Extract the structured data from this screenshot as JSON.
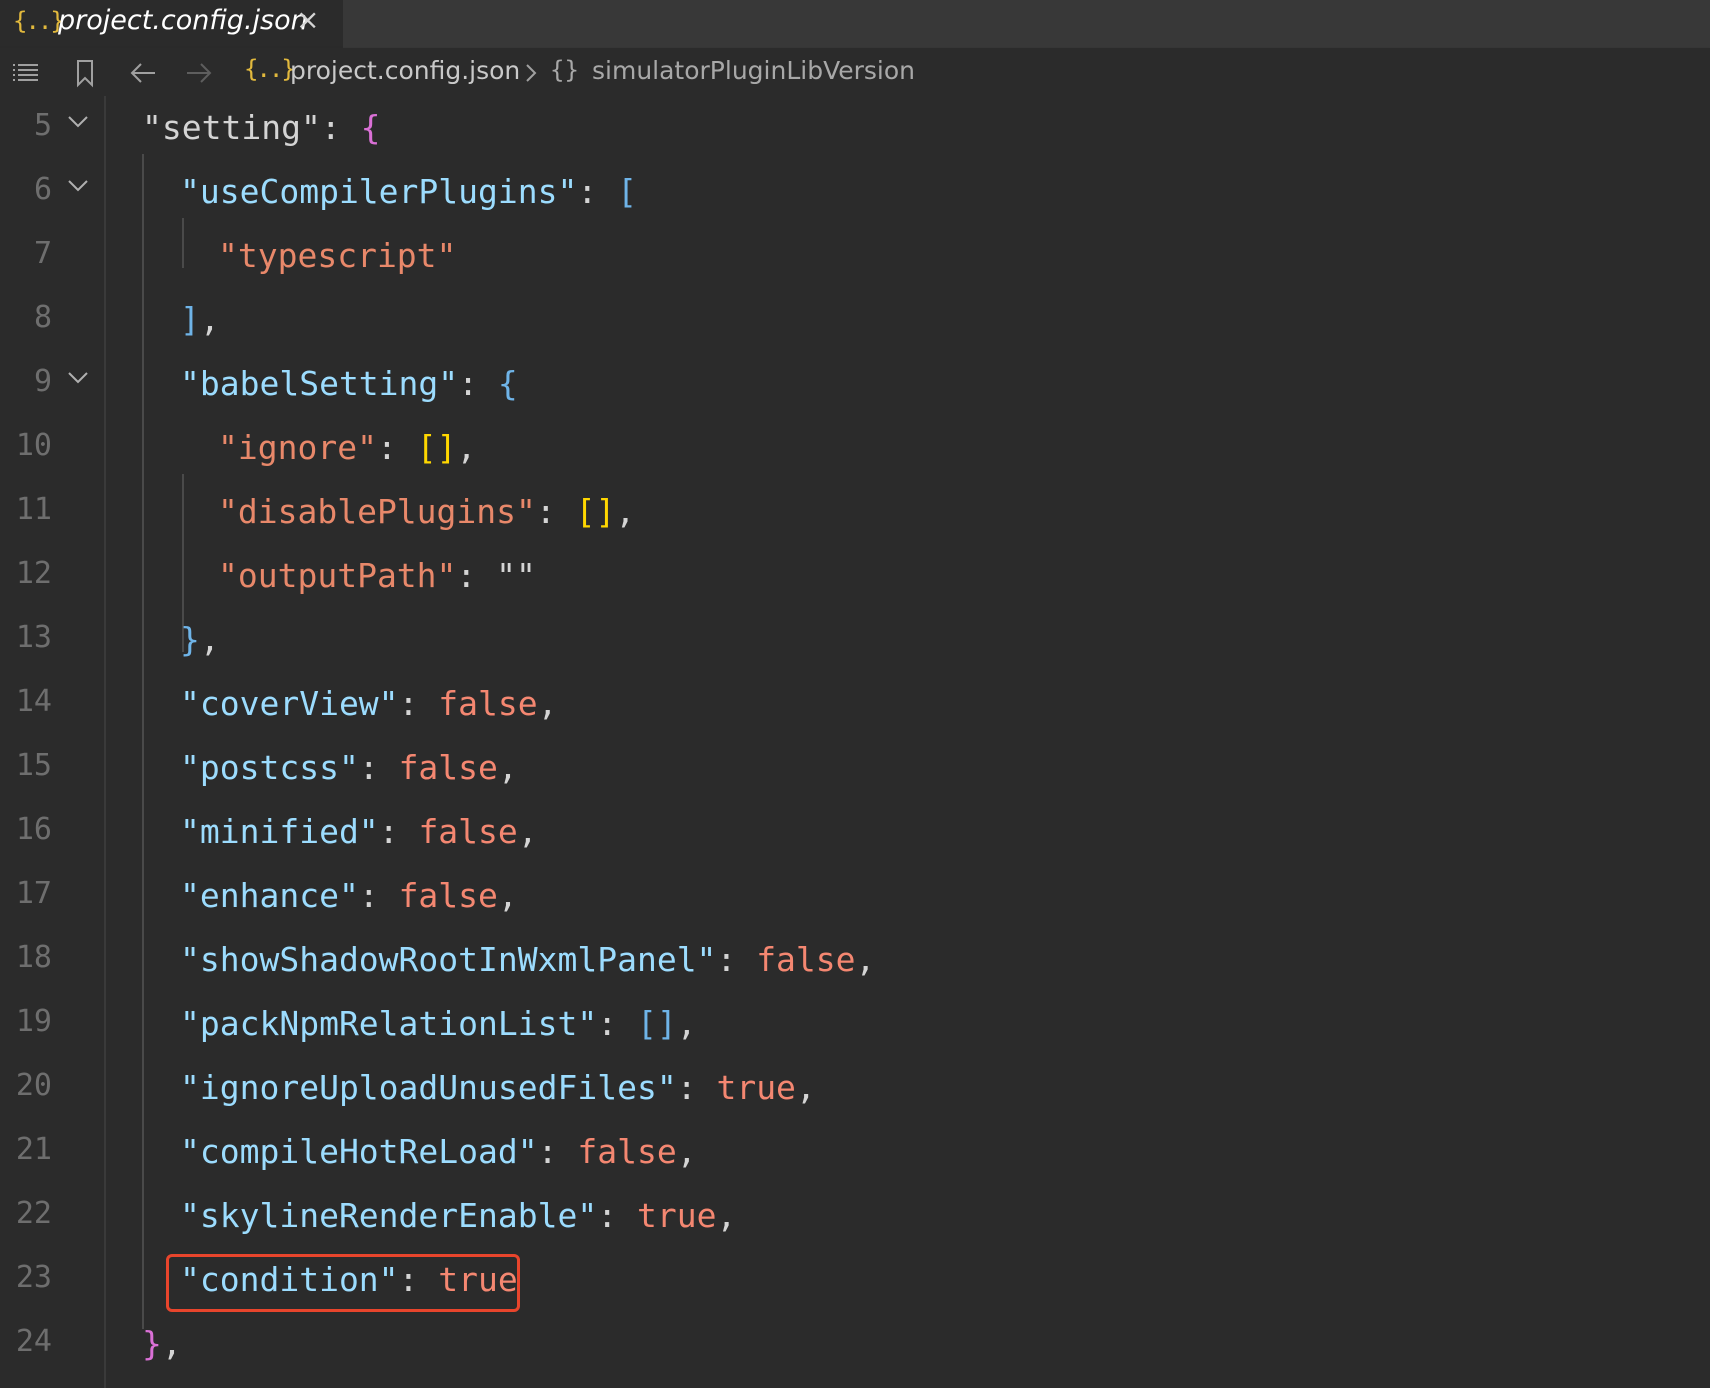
{
  "tab": {
    "icon_glyph": "{..}",
    "title": "project.config.json",
    "close_glyph": "×"
  },
  "breadcrumb": {
    "file_icon_glyph": "{..}",
    "file": "project.config.json",
    "object_icon_glyph": "{}",
    "key": "simulatorPluginLibVersion"
  },
  "editor": {
    "lines": [
      {
        "n": "5",
        "fold": true,
        "indent": 0,
        "tokens": [
          {
            "t": "\"setting\"",
            "c": "k1"
          },
          {
            "t": ": ",
            "c": "pu"
          },
          {
            "t": "{",
            "c": "b1"
          }
        ]
      },
      {
        "n": "6",
        "fold": true,
        "indent": 1,
        "tokens": [
          {
            "t": "\"useCompilerPlugins\"",
            "c": "k"
          },
          {
            "t": ": ",
            "c": "pu"
          },
          {
            "t": "[",
            "c": "b2"
          }
        ]
      },
      {
        "n": "7",
        "fold": false,
        "indent": 2,
        "tokens": [
          {
            "t": "\"typescript\"",
            "c": "s"
          }
        ]
      },
      {
        "n": "8",
        "fold": false,
        "indent": 1,
        "tokens": [
          {
            "t": "]",
            "c": "b2"
          },
          {
            "t": ",",
            "c": "pu"
          }
        ]
      },
      {
        "n": "9",
        "fold": true,
        "indent": 1,
        "tokens": [
          {
            "t": "\"babelSetting\"",
            "c": "k"
          },
          {
            "t": ": ",
            "c": "pu"
          },
          {
            "t": "{",
            "c": "b2"
          }
        ]
      },
      {
        "n": "10",
        "fold": false,
        "indent": 2,
        "tokens": [
          {
            "t": "\"ignore\"",
            "c": "s"
          },
          {
            "t": ": ",
            "c": "pu"
          },
          {
            "t": "[]",
            "c": "b3"
          },
          {
            "t": ",",
            "c": "pu"
          }
        ]
      },
      {
        "n": "11",
        "fold": false,
        "indent": 2,
        "tokens": [
          {
            "t": "\"disablePlugins\"",
            "c": "s"
          },
          {
            "t": ": ",
            "c": "pu"
          },
          {
            "t": "[]",
            "c": "b3"
          },
          {
            "t": ",",
            "c": "pu"
          }
        ]
      },
      {
        "n": "12",
        "fold": false,
        "indent": 2,
        "tokens": [
          {
            "t": "\"outputPath\"",
            "c": "s"
          },
          {
            "t": ": ",
            "c": "pu"
          },
          {
            "t": "\"\"",
            "c": "k1"
          }
        ]
      },
      {
        "n": "13",
        "fold": false,
        "indent": 1,
        "tokens": [
          {
            "t": "}",
            "c": "b2"
          },
          {
            "t": ",",
            "c": "pu"
          }
        ]
      },
      {
        "n": "14",
        "fold": false,
        "indent": 1,
        "tokens": [
          {
            "t": "\"coverView\"",
            "c": "k"
          },
          {
            "t": ": ",
            "c": "pu"
          },
          {
            "t": "false",
            "c": "lit"
          },
          {
            "t": ",",
            "c": "pu"
          }
        ]
      },
      {
        "n": "15",
        "fold": false,
        "indent": 1,
        "tokens": [
          {
            "t": "\"postcss\"",
            "c": "k"
          },
          {
            "t": ": ",
            "c": "pu"
          },
          {
            "t": "false",
            "c": "lit"
          },
          {
            "t": ",",
            "c": "pu"
          }
        ]
      },
      {
        "n": "16",
        "fold": false,
        "indent": 1,
        "tokens": [
          {
            "t": "\"minified\"",
            "c": "k"
          },
          {
            "t": ": ",
            "c": "pu"
          },
          {
            "t": "false",
            "c": "lit"
          },
          {
            "t": ",",
            "c": "pu"
          }
        ]
      },
      {
        "n": "17",
        "fold": false,
        "indent": 1,
        "tokens": [
          {
            "t": "\"enhance\"",
            "c": "k"
          },
          {
            "t": ": ",
            "c": "pu"
          },
          {
            "t": "false",
            "c": "lit"
          },
          {
            "t": ",",
            "c": "pu"
          }
        ]
      },
      {
        "n": "18",
        "fold": false,
        "indent": 1,
        "tokens": [
          {
            "t": "\"showShadowRootInWxmlPanel\"",
            "c": "k"
          },
          {
            "t": ": ",
            "c": "pu"
          },
          {
            "t": "false",
            "c": "lit"
          },
          {
            "t": ",",
            "c": "pu"
          }
        ]
      },
      {
        "n": "19",
        "fold": false,
        "indent": 1,
        "tokens": [
          {
            "t": "\"packNpmRelationList\"",
            "c": "k"
          },
          {
            "t": ": ",
            "c": "pu"
          },
          {
            "t": "[]",
            "c": "b2"
          },
          {
            "t": ",",
            "c": "pu"
          }
        ]
      },
      {
        "n": "20",
        "fold": false,
        "indent": 1,
        "tokens": [
          {
            "t": "\"ignoreUploadUnusedFiles\"",
            "c": "k"
          },
          {
            "t": ": ",
            "c": "pu"
          },
          {
            "t": "true",
            "c": "lit"
          },
          {
            "t": ",",
            "c": "pu"
          }
        ]
      },
      {
        "n": "21",
        "fold": false,
        "indent": 1,
        "tokens": [
          {
            "t": "\"compileHotReLoad\"",
            "c": "k"
          },
          {
            "t": ": ",
            "c": "pu"
          },
          {
            "t": "false",
            "c": "lit"
          },
          {
            "t": ",",
            "c": "pu"
          }
        ]
      },
      {
        "n": "22",
        "fold": false,
        "indent": 1,
        "tokens": [
          {
            "t": "\"skylineRenderEnable\"",
            "c": "k"
          },
          {
            "t": ": ",
            "c": "pu"
          },
          {
            "t": "true",
            "c": "lit"
          },
          {
            "t": ",",
            "c": "pu"
          }
        ]
      },
      {
        "n": "23",
        "fold": false,
        "indent": 1,
        "tokens": [
          {
            "t": "\"condition\"",
            "c": "k"
          },
          {
            "t": ": ",
            "c": "pu"
          },
          {
            "t": "true",
            "c": "lit"
          }
        ]
      },
      {
        "n": "24",
        "fold": false,
        "indent": 0,
        "tokens": [
          {
            "t": "}",
            "c": "b1"
          },
          {
            "t": ",",
            "c": "pu"
          }
        ]
      }
    ]
  },
  "colors": {
    "background": "#2b2b2b",
    "tabbar": "#383838",
    "json_icon": "#e2b93d",
    "highlight_border": "#e8452c"
  }
}
